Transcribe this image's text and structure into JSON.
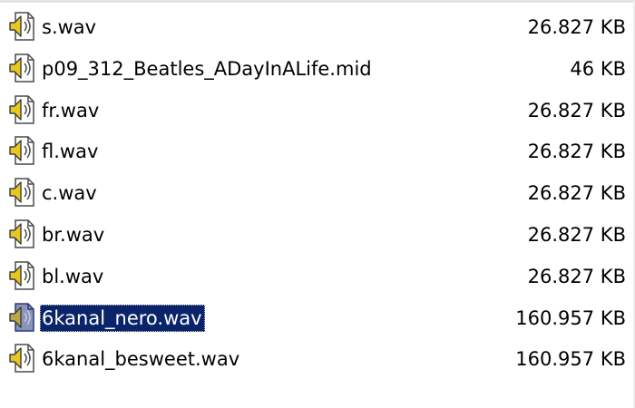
{
  "files": [
    {
      "name": "s.wav",
      "size": "26.827 KB",
      "icon": "audio-file-icon",
      "selected": false
    },
    {
      "name": "p09_312_Beatles_ADayInALife.mid",
      "size": "46 KB",
      "icon": "audio-file-icon",
      "selected": false
    },
    {
      "name": "fr.wav",
      "size": "26.827 KB",
      "icon": "audio-file-icon",
      "selected": false
    },
    {
      "name": "fl.wav",
      "size": "26.827 KB",
      "icon": "audio-file-icon",
      "selected": false
    },
    {
      "name": "c.wav",
      "size": "26.827 KB",
      "icon": "audio-file-icon",
      "selected": false
    },
    {
      "name": "br.wav",
      "size": "26.827 KB",
      "icon": "audio-file-icon",
      "selected": false
    },
    {
      "name": "bl.wav",
      "size": "26.827 KB",
      "icon": "audio-file-icon",
      "selected": false
    },
    {
      "name": "6kanal_nero.wav",
      "size": "160.957 KB",
      "icon": "audio-file-icon",
      "selected": true
    },
    {
      "name": "6kanal_besweet.wav",
      "size": "160.957 KB",
      "icon": "audio-file-icon",
      "selected": false
    }
  ],
  "colors": {
    "selection_bg": "#0a246a",
    "selection_text": "#ffffff",
    "text": "#000000",
    "background": "#ffffff"
  }
}
